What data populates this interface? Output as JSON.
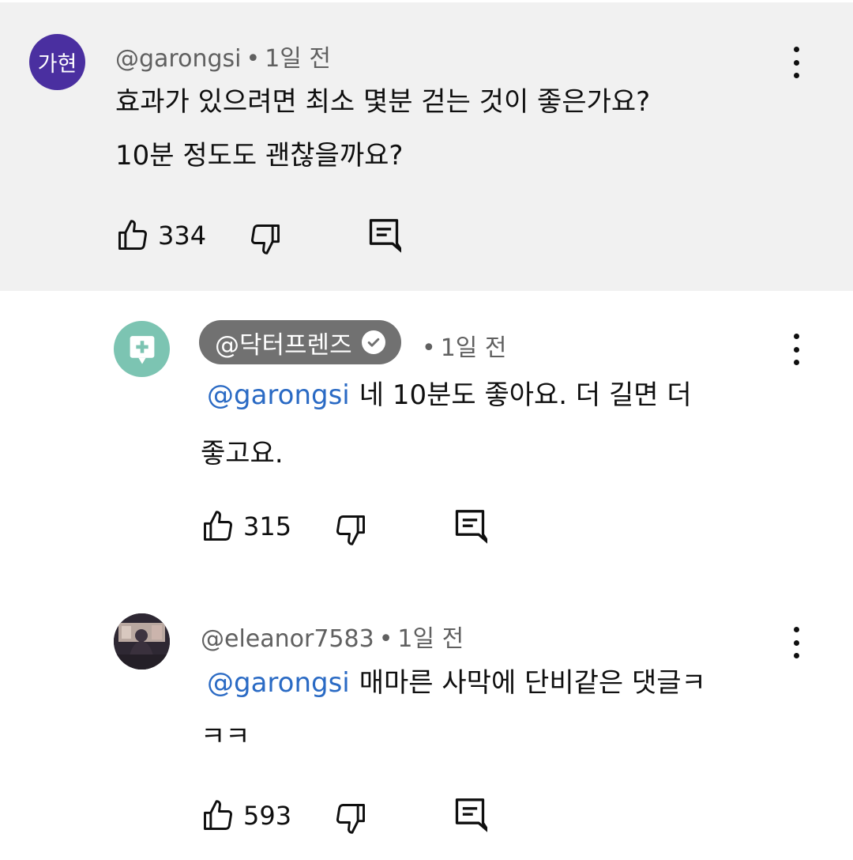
{
  "comments": [
    {
      "avatar_text": "가현",
      "avatar_color": "#4a2fa0",
      "author": "@garongsi",
      "time": "1일 전",
      "lines": [
        "효과가 있으려면 최소 몇분 걷는 것이 좋은가요?",
        "10분 정도도 괜찮을까요?"
      ],
      "likes": "334"
    }
  ],
  "replies": [
    {
      "author": "@닥터프렌즈",
      "verified": true,
      "avatar_color": "#7cc4b2",
      "time": "1일 전",
      "mention": "@garongsi",
      "line1": "네 10분도 좋아요. 더 길면 더",
      "line2": "좋고요.",
      "likes": "315"
    },
    {
      "author": "@eleanor7583",
      "time": "1일 전",
      "mention": "@garongsi",
      "line1": "매마른 사막에 단비같은 댓글ㅋ",
      "line2": "ㅋㅋ",
      "likes": "593"
    }
  ],
  "separator": "•",
  "icons": {
    "like": "thumb-up-outline-icon",
    "dislike": "thumb-down-outline-icon",
    "reply": "reply-comment-icon",
    "more": "more-vert-icon",
    "verified": "verified-check-icon",
    "channel_logo": "medical-plus-chat-icon"
  },
  "colors": {
    "mention": "#2a6ac4",
    "highlight_bg": "#f1f1f1",
    "chip_bg": "#717171"
  }
}
